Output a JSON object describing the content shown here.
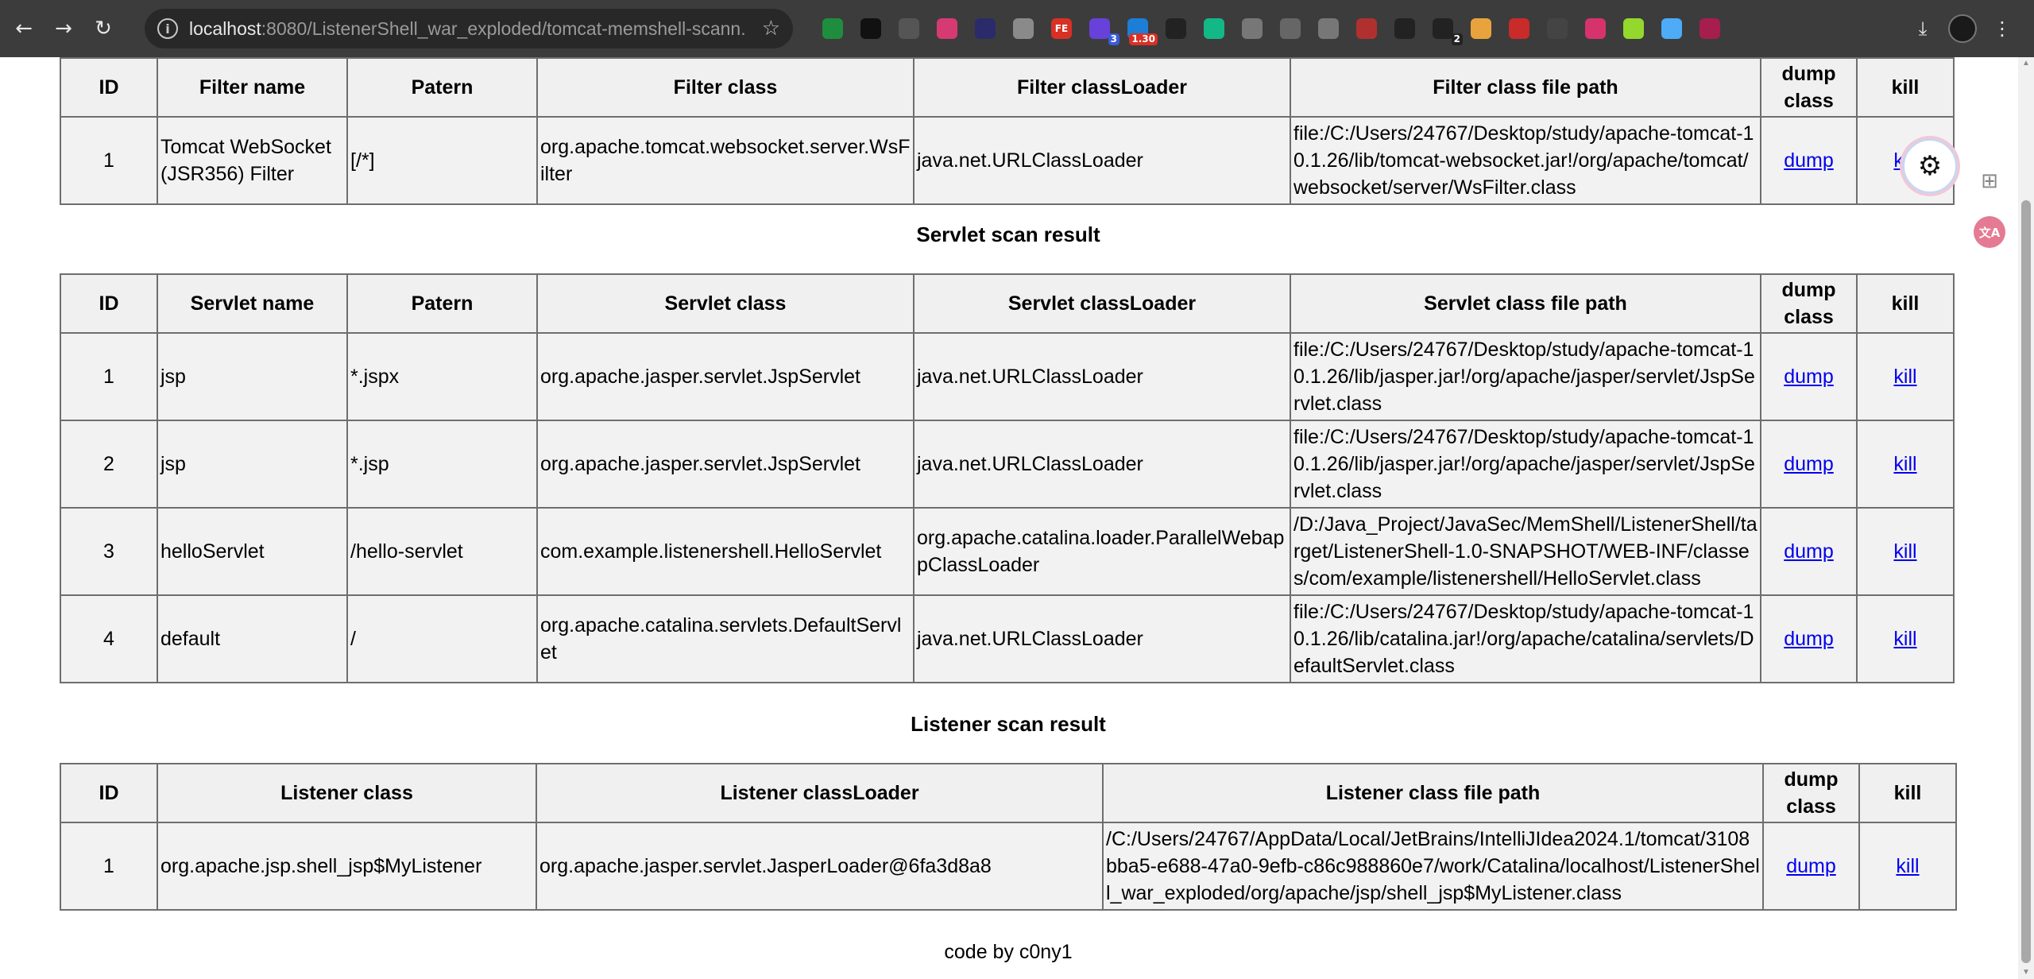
{
  "browser": {
    "url_host": "localhost",
    "url_rest": ":8080/ListenerShell_war_exploded/tomcat-memshell-scann...",
    "extensions": [
      {
        "icon": "shield-ext-icon",
        "color": "#1e8e3e",
        "label": ""
      },
      {
        "icon": "square-ext-icon",
        "color": "#111111",
        "label": ""
      },
      {
        "icon": "hat-ext-icon",
        "color": "#555555",
        "label": ""
      },
      {
        "icon": "translate-ext-icon",
        "color": "#d63a73",
        "label": ""
      },
      {
        "icon": "terminal-ext-icon",
        "color": "#2b2b6b",
        "label": ""
      },
      {
        "icon": "vue-ext-icon",
        "color": "#8a8a8a",
        "label": ""
      },
      {
        "icon": "fe-ext-icon",
        "color": "#d93025",
        "label": "FE"
      },
      {
        "icon": "hexagon-ext-icon",
        "color": "#6741d9",
        "label": "",
        "badge": "3",
        "badge_color": "blue"
      },
      {
        "icon": "timer-ext-icon",
        "color": "#1c7ed6",
        "label": "",
        "badge": "1.30",
        "badge_color": "red"
      },
      {
        "icon": "qr-ext-icon",
        "color": "#222222",
        "label": ""
      },
      {
        "icon": "refresh-ext-icon",
        "color": "#12b886",
        "label": ""
      },
      {
        "icon": "puzzle-grey-ext-icon",
        "color": "#777777",
        "label": ""
      },
      {
        "icon": "copy-ext-icon",
        "color": "#666666",
        "label": ""
      },
      {
        "icon": "gear-ext-icon",
        "color": "#777777",
        "label": ""
      },
      {
        "icon": "spin-ext-icon",
        "color": "#b03030",
        "label": ""
      },
      {
        "icon": "qr2-ext-icon",
        "color": "#222222",
        "label": ""
      },
      {
        "icon": "puzzle-badge-ext-icon",
        "color": "#222222",
        "label": "",
        "badge": "2",
        "badge_color": "dark"
      },
      {
        "icon": "search-ext-icon",
        "color": "#e8a33d",
        "label": ""
      },
      {
        "icon": "recorder-ext-icon",
        "color": "#c92a2a",
        "label": ""
      },
      {
        "icon": "glasses-ext-icon",
        "color": "#444444",
        "label": ""
      },
      {
        "icon": "bookmark-ext-icon",
        "color": "#d6336c",
        "label": ""
      },
      {
        "icon": "dice-ext-icon",
        "color": "#94d82d",
        "label": ""
      },
      {
        "icon": "cube-ext-icon",
        "color": "#4dabf7",
        "label": ""
      },
      {
        "icon": "robot-ext-icon",
        "color": "#a61e4d",
        "label": ""
      }
    ]
  },
  "filter_table": {
    "headers": [
      "ID",
      "Filter name",
      "Patern",
      "Filter class",
      "Filter classLoader",
      "Filter class file path",
      "dump class",
      "kill"
    ],
    "rows": [
      {
        "id": "1",
        "name": "Tomcat WebSocket (JSR356) Filter",
        "pattern": "[/*]",
        "class": "org.apache.tomcat.websocket.server.WsFilter",
        "loader": "java.net.URLClassLoader",
        "path": "file:/C:/Users/24767/Desktop/study/apache-tomcat-10.1.26/lib/tomcat-websocket.jar!/org/apache/tomcat/websocket/server/WsFilter.class",
        "dump": "dump",
        "kill": "kill"
      }
    ]
  },
  "servlet_section_title": "Servlet scan result",
  "servlet_table": {
    "headers": [
      "ID",
      "Servlet name",
      "Patern",
      "Servlet class",
      "Servlet classLoader",
      "Servlet class file path",
      "dump class",
      "kill"
    ],
    "rows": [
      {
        "id": "1",
        "name": "jsp",
        "pattern": "*.jspx",
        "class": "org.apache.jasper.servlet.JspServlet",
        "loader": "java.net.URLClassLoader",
        "path": "file:/C:/Users/24767/Desktop/study/apache-tomcat-10.1.26/lib/jasper.jar!/org/apache/jasper/servlet/JspServlet.class",
        "dump": "dump",
        "kill": "kill"
      },
      {
        "id": "2",
        "name": "jsp",
        "pattern": "*.jsp",
        "class": "org.apache.jasper.servlet.JspServlet",
        "loader": "java.net.URLClassLoader",
        "path": "file:/C:/Users/24767/Desktop/study/apache-tomcat-10.1.26/lib/jasper.jar!/org/apache/jasper/servlet/JspServlet.class",
        "dump": "dump",
        "kill": "kill"
      },
      {
        "id": "3",
        "name": "helloServlet",
        "pattern": "/hello-servlet",
        "class": "com.example.listenershell.HelloServlet",
        "loader": "org.apache.catalina.loader.ParallelWebappClassLoader",
        "path": "/D:/Java_Project/JavaSec/MemShell/ListenerShell/target/ListenerShell-1.0-SNAPSHOT/WEB-INF/classes/com/example/listenershell/HelloServlet.class",
        "dump": "dump",
        "kill": "kill"
      },
      {
        "id": "4",
        "name": "default",
        "pattern": "/",
        "class": "org.apache.catalina.servlets.DefaultServlet",
        "loader": "java.net.URLClassLoader",
        "path": "file:/C:/Users/24767/Desktop/study/apache-tomcat-10.1.26/lib/catalina.jar!/org/apache/catalina/servlets/DefaultServlet.class",
        "dump": "dump",
        "kill": "kill"
      }
    ]
  },
  "listener_section_title": "Listener scan result",
  "listener_table": {
    "headers": [
      "ID",
      "Listener class",
      "Listener classLoader",
      "Listener class file path",
      "dump class",
      "kill"
    ],
    "rows": [
      {
        "id": "1",
        "class": "org.apache.jsp.shell_jsp$MyListener",
        "loader": "org.apache.jasper.servlet.JasperLoader@6fa3d8a8",
        "path": "/C:/Users/24767/AppData/Local/JetBrains/IntelliJIdea2024.1/tomcat/3108bba5-e688-47a0-9efb-c86c988860e7/work/Catalina/localhost/ListenerShell_war_exploded/org/apache/jsp/shell_jsp$MyListener.class",
        "dump": "dump",
        "kill": "kill"
      }
    ]
  },
  "footer": "code by c0ny1",
  "side": {
    "translate_label": "文A"
  }
}
